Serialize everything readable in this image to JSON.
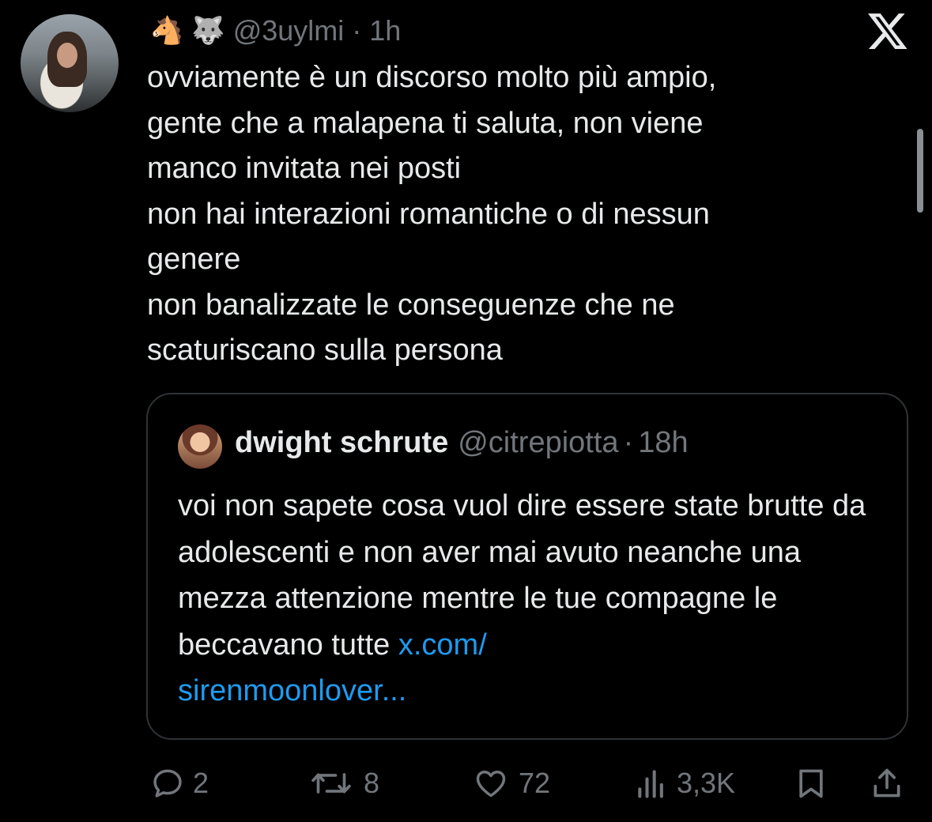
{
  "tweet": {
    "author_emojis": [
      "🐴",
      "🐺"
    ],
    "handle": "@3uylmi",
    "time": "1h",
    "text": "ovviamente è un discorso molto più ampio,\ngente che a malapena ti saluta, non viene\nmanco invitata nei posti\nnon hai interazioni romantiche o di nessun\ngenere\nnon banalizzate le conseguenze che ne\nscaturiscano sulla persona"
  },
  "quoted": {
    "name": "dwight schrute",
    "handle": "@citrepiotta",
    "time": "18h",
    "text": "voi non sapete cosa vuol dire essere state brutte da adolescenti e non aver mai avuto neanche una mezza attenzione mentre le tue compagne le beccavano tutte ",
    "link_line1": "x.com/",
    "link_line2": "sirenmoonlover..."
  },
  "actions": {
    "replies": "2",
    "reposts": "8",
    "likes": "72",
    "views": "3,3K"
  },
  "colors": {
    "background": "#000000",
    "text": "#e7e9ea",
    "secondary": "#71767b",
    "link": "#1d9bf0",
    "border": "#2f3336"
  },
  "icons": [
    "x-logo-icon",
    "reply-icon",
    "repost-icon",
    "like-icon",
    "views-icon",
    "bookmark-icon",
    "share-icon"
  ]
}
